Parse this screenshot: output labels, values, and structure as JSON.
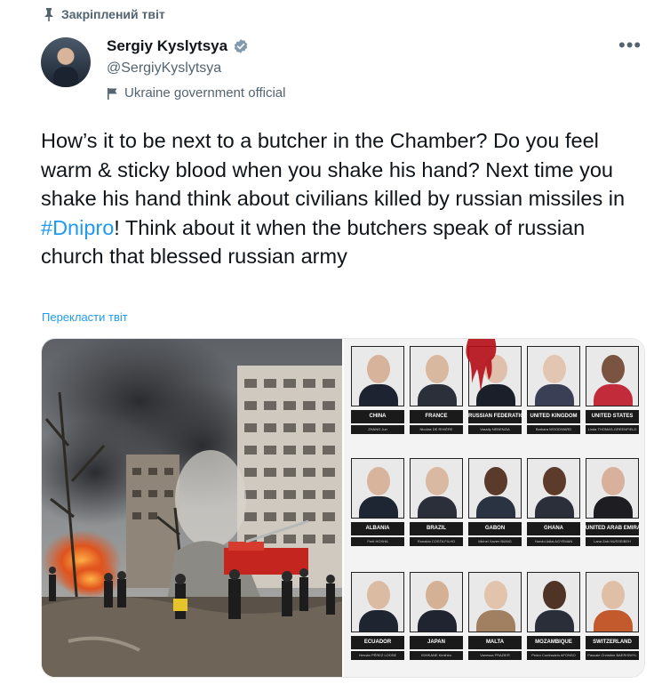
{
  "pinned_label": "Закріплений твіт",
  "author": {
    "name": "Sergiy Kyslytsya",
    "handle": "@SergiyKyslytsya",
    "label": "Ukraine government official"
  },
  "more_label": "•••",
  "tweet": {
    "text_before": "How’s it to be next to a butcher in the Chamber? Do you feel warm & sticky blood when you shake his hand? Next time you shake his hand think about civilians killed by russian missiles in ",
    "hashtag": "#Dnipro",
    "text_after": "! Think about it when the butchers speak of russian church that blessed russian army"
  },
  "translate_label": "Перекласти твіт",
  "colors": {
    "accent": "#1d9bf0",
    "verified": "#829aab",
    "secondary": "#536471"
  },
  "council_members": [
    {
      "country": "CHINA",
      "rep": "ZHANG Jun",
      "skin": "#d6b39a",
      "suit": "#1d2330"
    },
    {
      "country": "FRANCE",
      "rep": "Nicolas DE RIVIÈRE",
      "skin": "#d9b8a0",
      "suit": "#2b2f3a"
    },
    {
      "country": "RUSSIAN FEDERATION",
      "rep": "Vassily NEBENZIA",
      "skin": "#e0c0ad",
      "suit": "#1a1f2a"
    },
    {
      "country": "UNITED KINGDOM",
      "rep": "Barbara WOODWARD",
      "skin": "#e3c6b2",
      "suit": "#3b3f55"
    },
    {
      "country": "UNITED STATES",
      "rep": "Linda THOMAS-GREENFIELD",
      "skin": "#7a5440",
      "suit": "#c22b3a"
    },
    {
      "country": "ALBANIA",
      "rep": "Ferit HOXHA",
      "skin": "#d8b49c",
      "suit": "#1f2633"
    },
    {
      "country": "BRAZIL",
      "rep": "Ronaldo COSTA FILHO",
      "skin": "#d9b9a1",
      "suit": "#2a2f39"
    },
    {
      "country": "GABON",
      "rep": "Michel Xavier BIANG",
      "skin": "#5a3a2a",
      "suit": "#2a3342"
    },
    {
      "country": "GHANA",
      "rep": "Harold Adlai AGYEMAN",
      "skin": "#5d3b2b",
      "suit": "#2b2f3a"
    },
    {
      "country": "UNITED ARAB EMIRATES",
      "rep": "Lana Zaki NUSSEIBEH",
      "skin": "#d7b19b",
      "suit": "#1e1e22"
    },
    {
      "country": "ECUADOR",
      "rep": "Hernán PÉREZ LOOSE",
      "skin": "#dcbba3",
      "suit": "#1f2530"
    },
    {
      "country": "JAPAN",
      "rep": "ISHIKANE Kimihiro",
      "skin": "#d4b195",
      "suit": "#1f2430"
    },
    {
      "country": "MALTA",
      "rep": "Vanessa FRAZIER",
      "skin": "#e2c3ab",
      "suit": "#a08060"
    },
    {
      "country": "MOZAMBIQUE",
      "rep": "Pedro Comissário AFONSO",
      "skin": "#4f3325",
      "suit": "#2a2e38"
    },
    {
      "country": "SWITZERLAND",
      "rep": "Pascale Christine BAERISWYL",
      "skin": "#e0bfa7",
      "suit": "#c25a2e"
    }
  ]
}
